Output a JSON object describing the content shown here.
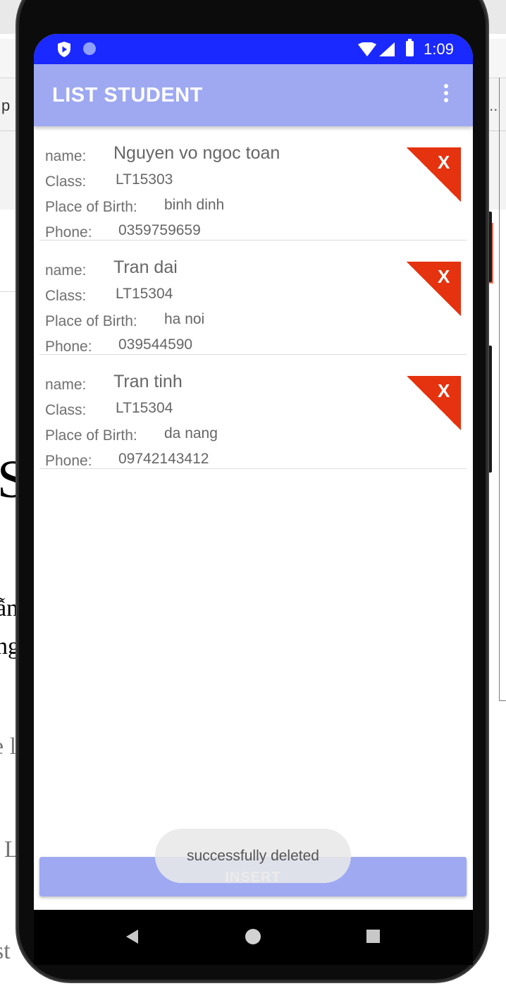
{
  "background_page": {
    "lines": [
      "p",
      "...",
      "S",
      "ẫn",
      "ng",
      "e l",
      "L",
      "st"
    ]
  },
  "status_bar": {
    "time": "1:09",
    "icons": [
      "shield-play-icon",
      "circle-notification-icon",
      "wifi-icon",
      "cell-signal-icon",
      "battery-icon"
    ]
  },
  "app_bar": {
    "title": "LIST STUDENT",
    "menu_icon": "more-vert-icon"
  },
  "student_labels": {
    "name": "name:",
    "class": "Class:",
    "place": "Place of Birth:",
    "phone": "Phone:",
    "delete": "X"
  },
  "students": [
    {
      "name": "Nguyen vo ngoc toan",
      "class": "LT15303",
      "place": "binh dinh",
      "phone": "0359759659"
    },
    {
      "name": "Tran dai",
      "class": "LT15304",
      "place": "ha noi",
      "phone": "039544590"
    },
    {
      "name": "Tran tinh",
      "class": "LT15304",
      "place": "da nang",
      "phone": "09742143412"
    }
  ],
  "insert_button": {
    "label": "INSERT"
  },
  "toast": {
    "message": "successfully deleted"
  },
  "nav_bar": {
    "icons": [
      "back-icon",
      "home-icon",
      "recents-icon"
    ]
  },
  "colors": {
    "status_bar": "#1a29ff",
    "app_bar": "#9ea9f2",
    "delete_button": "#e02b0f"
  }
}
